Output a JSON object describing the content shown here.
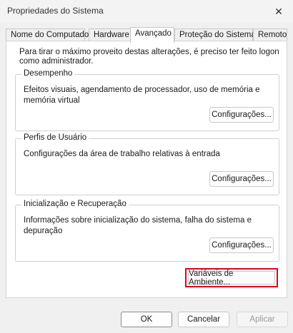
{
  "window": {
    "title": "Propriedades do Sistema"
  },
  "tabs": [
    {
      "label": "Nome do Computador"
    },
    {
      "label": "Hardware"
    },
    {
      "label": "Avançado"
    },
    {
      "label": "Proteção do Sistema"
    },
    {
      "label": "Remoto"
    }
  ],
  "active_tab": "Avançado",
  "note": "Para tirar o máximo proveito destas alterações, é preciso ter feito logon como administrador.",
  "groups": {
    "performance": {
      "title": "Desempenho",
      "text": "Efeitos visuais, agendamento de processador, uso de memória e memória virtual",
      "button": "Configurações..."
    },
    "profiles": {
      "title": "Perfis de Usuário",
      "text": "Configurações da área de trabalho relativas à entrada",
      "button": "Configurações..."
    },
    "startup": {
      "title": "Inicialização e Recuperação",
      "text": "Informações sobre inicialização do sistema, falha do sistema e depuração",
      "button": "Configurações..."
    }
  },
  "env_button": "Variáveis de Ambiente...",
  "footer": {
    "ok": "OK",
    "cancel": "Cancelar",
    "apply": "Aplicar"
  },
  "colors": {
    "highlight": "#e0001b"
  }
}
